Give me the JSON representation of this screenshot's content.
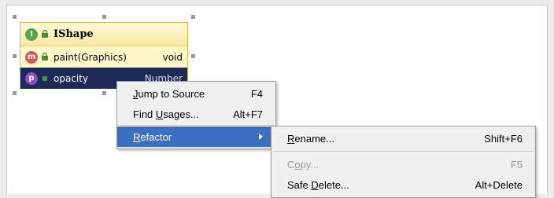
{
  "class_box": {
    "kind_badge": "I",
    "name": "IShape",
    "members": [
      {
        "badge": "m",
        "name": "paint(Graphics)",
        "type": "void"
      },
      {
        "badge": "p",
        "name": "opacity",
        "type": "Number"
      }
    ]
  },
  "context_menu": {
    "items": [
      {
        "pre": "",
        "mn": "J",
        "post": "ump to Source",
        "shortcut": "F4"
      },
      {
        "pre": "Find ",
        "mn": "U",
        "post": "sages...",
        "shortcut": "Alt+F7"
      },
      {
        "pre": "",
        "mn": "R",
        "post": "efactor",
        "shortcut": ""
      }
    ]
  },
  "refactor_menu": {
    "items": [
      {
        "pre": "",
        "mn": "R",
        "post": "ename...",
        "shortcut": "Shift+F6"
      },
      {
        "pre": "C",
        "mn": "o",
        "post": "py...",
        "shortcut": "F5"
      },
      {
        "pre": "Safe ",
        "mn": "D",
        "post": "elete...",
        "shortcut": "Alt+Delete"
      }
    ]
  },
  "colors": {
    "selection": "#3b6fc4",
    "selected_row": "#1e2a55",
    "class_border": "#d8b84a"
  },
  "icons": [
    "interface-icon",
    "lock-icon",
    "method-icon",
    "property-icon",
    "submenu-arrow-icon"
  ]
}
